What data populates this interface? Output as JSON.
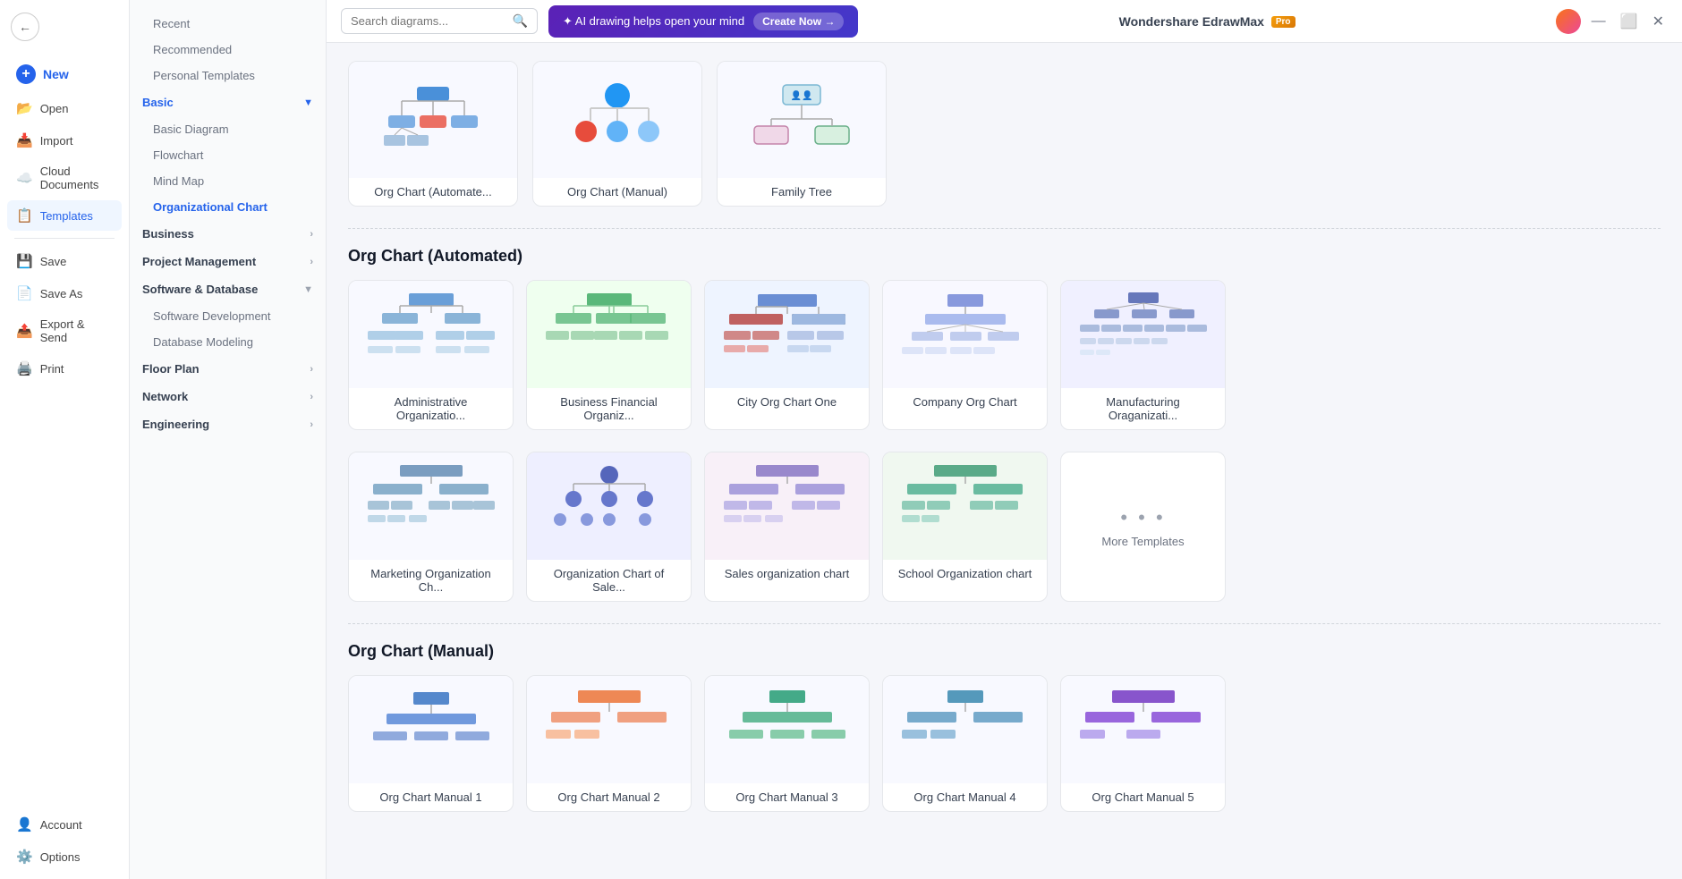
{
  "app": {
    "title": "Wondershare EdrawMax",
    "pro_badge": "Pro"
  },
  "topbar": {
    "search_placeholder": "Search diagrams...",
    "ai_banner_text": "✦ AI drawing helps open your mind",
    "create_now": "Create Now →"
  },
  "sidebar": {
    "back_label": "←",
    "items": [
      {
        "id": "new",
        "label": "New",
        "icon": "🆕"
      },
      {
        "id": "open",
        "label": "Open",
        "icon": "📂"
      },
      {
        "id": "import",
        "label": "Import",
        "icon": "📥"
      },
      {
        "id": "cloud",
        "label": "Cloud Documents",
        "icon": "☁️"
      },
      {
        "id": "templates",
        "label": "Templates",
        "icon": "📋"
      },
      {
        "id": "save",
        "label": "Save",
        "icon": "💾"
      },
      {
        "id": "save-as",
        "label": "Save As",
        "icon": "📄"
      },
      {
        "id": "export",
        "label": "Export & Send",
        "icon": "📤"
      },
      {
        "id": "print",
        "label": "Print",
        "icon": "🖨️"
      }
    ],
    "bottom_items": [
      {
        "id": "account",
        "label": "Account",
        "icon": "👤"
      },
      {
        "id": "options",
        "label": "Options",
        "icon": "⚙️"
      }
    ]
  },
  "middle_panel": {
    "recent_label": "Recent",
    "recommended_label": "Recommended",
    "personal_templates_label": "Personal Templates",
    "categories": [
      {
        "id": "basic",
        "label": "Basic",
        "active": true,
        "expanded": true,
        "children": [
          "Basic Diagram",
          "Flowchart",
          "Mind Map",
          "Organizational Chart"
        ]
      },
      {
        "id": "business",
        "label": "Business",
        "expanded": false
      },
      {
        "id": "project",
        "label": "Project Management",
        "expanded": false
      },
      {
        "id": "software",
        "label": "Software & Database",
        "expanded": true,
        "children": [
          "Software Development",
          "Database Modeling"
        ]
      },
      {
        "id": "floor",
        "label": "Floor Plan",
        "expanded": false
      },
      {
        "id": "network",
        "label": "Network",
        "expanded": false
      },
      {
        "id": "engineering",
        "label": "Engineering",
        "expanded": false
      }
    ]
  },
  "content": {
    "top_section": {
      "cards": [
        {
          "id": "org-auto",
          "label": "Org Chart (Automate...",
          "type": "org-auto"
        },
        {
          "id": "org-manual",
          "label": "Org Chart (Manual)",
          "type": "org-manual"
        },
        {
          "id": "family-tree",
          "label": "Family Tree",
          "type": "family-tree"
        }
      ]
    },
    "sections": [
      {
        "id": "org-automated",
        "title": "Org Chart (Automated)",
        "templates": [
          {
            "id": "admin-org",
            "label": "Administrative Organizatio...",
            "type": "admin-org"
          },
          {
            "id": "biz-financial",
            "label": "Business Financial Organiz...",
            "type": "biz-financial"
          },
          {
            "id": "city-org",
            "label": "City Org Chart One",
            "type": "city-org"
          },
          {
            "id": "company-org",
            "label": "Company Org Chart",
            "type": "company-org"
          },
          {
            "id": "manufacturing",
            "label": "Manufacturing Oraganizati...",
            "type": "manufacturing"
          }
        ],
        "row2": [
          {
            "id": "marketing-org",
            "label": "Marketing Organization Ch...",
            "type": "marketing-org"
          },
          {
            "id": "org-chart-sales",
            "label": "Organization Chart of Sale...",
            "type": "org-chart-sales"
          },
          {
            "id": "sales-org",
            "label": "Sales organization chart",
            "type": "sales-org"
          },
          {
            "id": "school-org",
            "label": "School Organization chart",
            "type": "school-org"
          }
        ],
        "more_templates_label": "More Templates"
      },
      {
        "id": "org-manual",
        "title": "Org Chart (Manual)"
      }
    ]
  }
}
